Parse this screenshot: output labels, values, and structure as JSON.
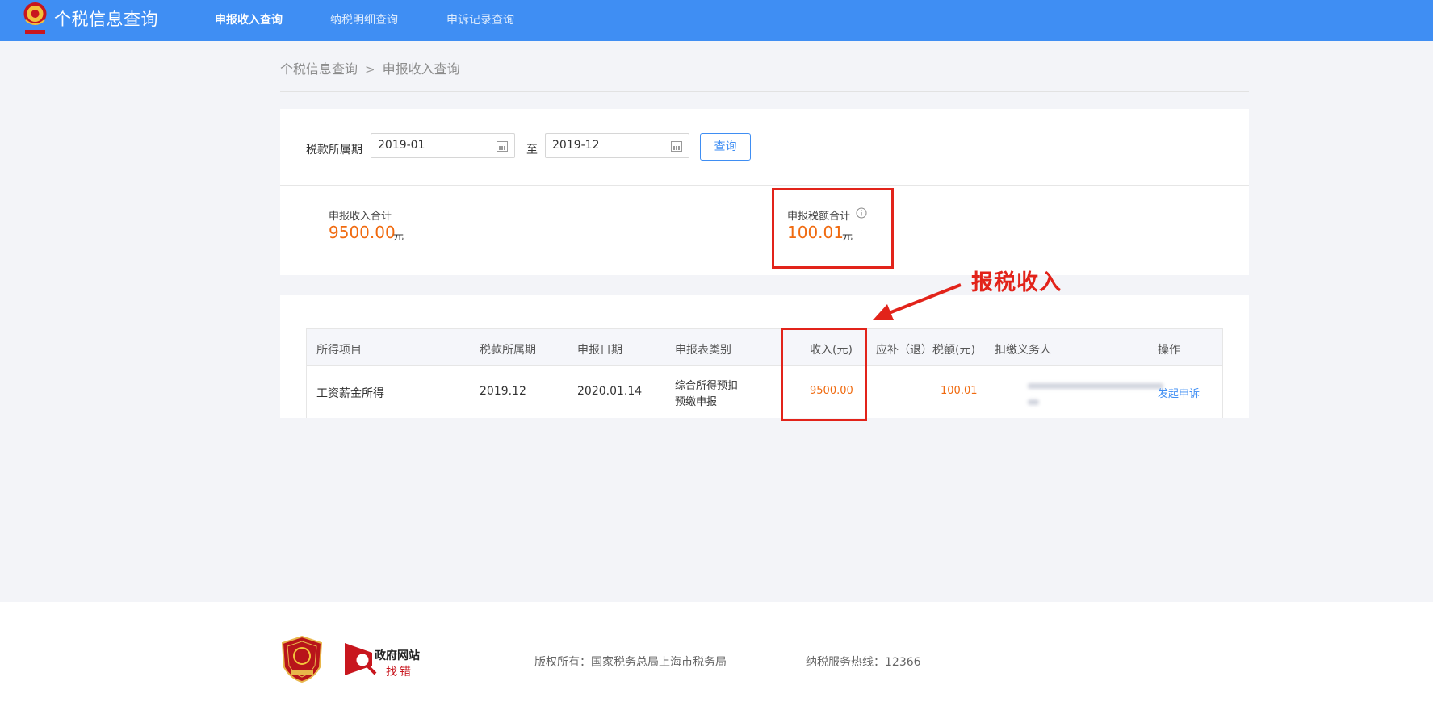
{
  "header": {
    "app_title": "个税信息查询",
    "nav": [
      {
        "label": "申报收入查询",
        "active": true
      },
      {
        "label": "纳税明细查询",
        "active": false
      },
      {
        "label": "申诉记录查询",
        "active": false
      }
    ]
  },
  "breadcrumb": {
    "root": "个税信息查询",
    "separator": ">",
    "current": "申报收入查询"
  },
  "query": {
    "period_label": "税款所属期",
    "start": "2019-01",
    "to_label": "至",
    "end": "2019-12",
    "button": "查询"
  },
  "summary": {
    "income_label": "申报收入合计",
    "income_value": "9500.00",
    "income_unit": "元",
    "tax_label": "申报税额合计",
    "tax_value": "100.01",
    "tax_unit": "元"
  },
  "table": {
    "columns": [
      "所得项目",
      "税款所属期",
      "申报日期",
      "申报表类别",
      "收入(元)",
      "应补（退）税额(元)",
      "扣缴义务人",
      "操作"
    ],
    "rows": [
      {
        "item": "工资薪金所得",
        "period": "2019.12",
        "date": "2020.01.14",
        "type_line1": "综合所得预扣",
        "type_line2": "预缴申报",
        "income": "9500.00",
        "tax": "100.01",
        "withholder": "",
        "action": "发起申诉"
      }
    ]
  },
  "annotation": {
    "label": "报税收入",
    "color": "#e2231a"
  },
  "footer": {
    "gov_site_line1": "政府网站",
    "gov_site_line2": "找错",
    "copyright": "版权所有：国家税务总局上海市税务局",
    "hotline": "纳税服务热线：12366"
  },
  "colors": {
    "header": "#3f8ef3",
    "accent_orange": "#f06a0f",
    "link_blue": "#3f8ef3"
  }
}
